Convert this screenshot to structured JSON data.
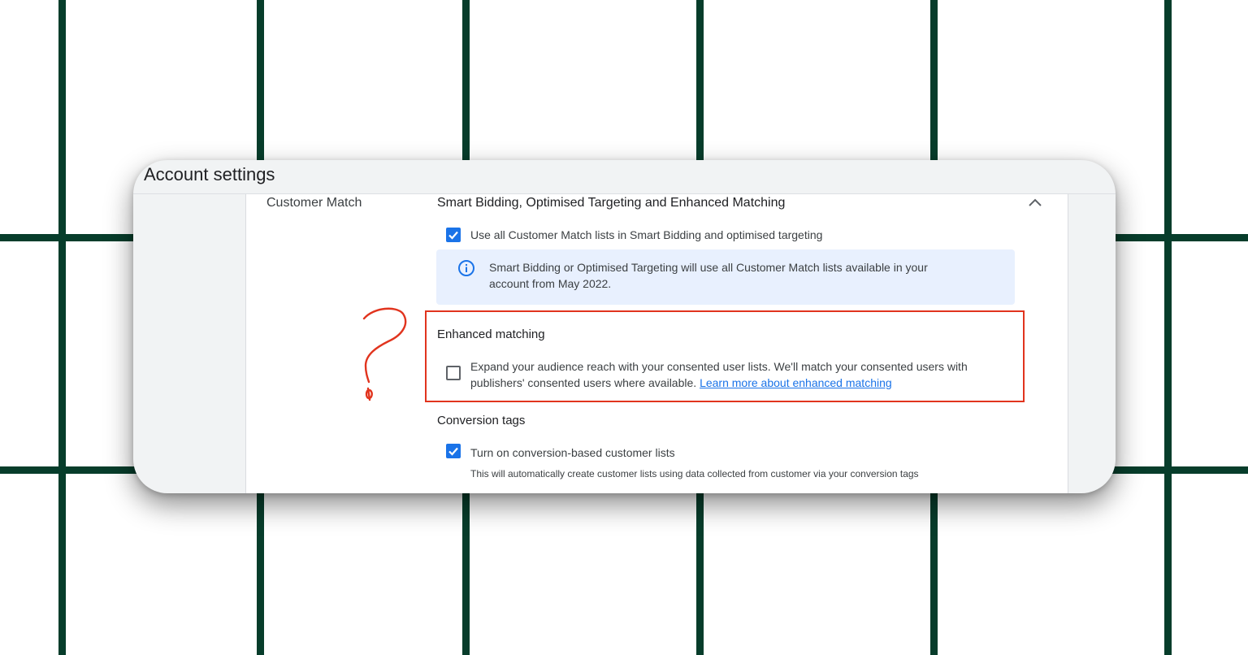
{
  "colors": {
    "background": "#ffffff",
    "grid_lines": "#073d2b",
    "card_bg": "#f1f3f4",
    "panel_bg": "#ffffff",
    "checkbox_blue": "#1a73e8",
    "info_box_bg": "#e8f0fe",
    "link": "#1a73e8",
    "highlight_red": "#e1341e"
  },
  "page": {
    "title": "Account settings"
  },
  "section": {
    "label": "Customer Match",
    "heading": "Smart Bidding, Optimised Targeting and Enhanced Matching",
    "collapse_icon": "chevron-up-icon"
  },
  "smart_bidding": {
    "checkbox_checked": true,
    "checkbox_label": "Use all Customer Match lists in Smart Bidding and optimised targeting",
    "info_icon": "info-icon",
    "info_line1": "Smart Bidding or Optimised Targeting will use all Customer Match lists available in your",
    "info_line2": "account from May 2022."
  },
  "enhanced_matching": {
    "heading": "Enhanced matching",
    "checkbox_checked": false,
    "text_line1": "Expand your audience reach with your consented user lists. We'll match your consented users with",
    "text_line2": "publishers' consented users where available. ",
    "link_text": "Learn more about enhanced matching"
  },
  "conversion_tags": {
    "heading": "Conversion tags",
    "checkbox_checked": true,
    "checkbox_label": "Turn on conversion-based customer lists",
    "description": "This will automatically create customer lists using data collected from customer via your conversion tags"
  },
  "annotation": {
    "symbol": "question-mark-scribble"
  }
}
